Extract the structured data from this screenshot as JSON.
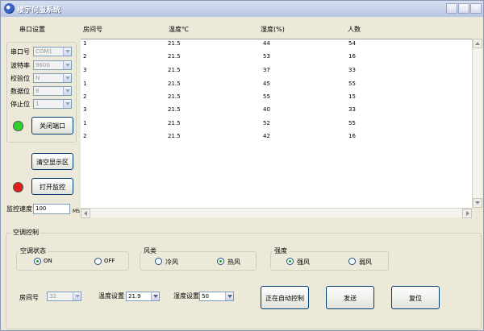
{
  "window": {
    "title": "楼宇伺服系统"
  },
  "serial": {
    "heading": "串口设置",
    "fields": [
      {
        "label": "串口号",
        "value": "COM1"
      },
      {
        "label": "波特率",
        "value": "9600"
      },
      {
        "label": "校验位",
        "value": "N"
      },
      {
        "label": "数据位",
        "value": "8"
      },
      {
        "label": "停止位",
        "value": "1"
      }
    ],
    "status_color": "#2fd12f",
    "close_port_button": "关闭端口"
  },
  "display": {
    "clear_button": "清空显示区"
  },
  "monitor": {
    "status_color": "#e41b1b",
    "open_button": "打开监控",
    "speed_label": "监控速度",
    "speed_value": "100",
    "speed_unit": "MS"
  },
  "table": {
    "headers": [
      "房间号",
      "温度℃",
      "湿度(%)",
      "人数"
    ],
    "rows": [
      [
        "1",
        "21.5",
        "44",
        "54"
      ],
      [
        "2",
        "21.5",
        "53",
        "16"
      ],
      [
        "3",
        "21.5",
        "37",
        "33"
      ],
      [
        "1",
        "21.5",
        "45",
        "55"
      ],
      [
        "2",
        "21.5",
        "55",
        "15"
      ],
      [
        "3",
        "21.5",
        "40",
        "33"
      ],
      [
        "1",
        "21.5",
        "52",
        "55"
      ],
      [
        "2",
        "21.5",
        "42",
        "16"
      ]
    ]
  },
  "ac": {
    "heading": "空调控制",
    "state": {
      "title": "空调状态",
      "on": "ON",
      "off": "OFF",
      "selected": "on"
    },
    "wind_type": {
      "title": "风类",
      "cold": "冷风",
      "hot": "热风",
      "selected": "hot"
    },
    "strength": {
      "title": "强度",
      "strong": "强风",
      "weak": "弱风",
      "selected": "strong"
    },
    "room_label": "房间号",
    "room_value": "32",
    "temp_label": "温度设置",
    "temp_value": "21.9",
    "humidity_label": "湿度设置",
    "humidity_value": "50",
    "auto_button": "正在自动控制",
    "send_button": "发送",
    "reset_button": "复位"
  }
}
